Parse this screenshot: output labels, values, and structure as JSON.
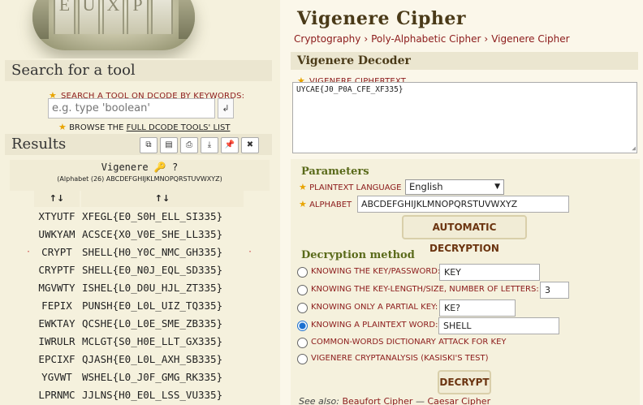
{
  "search": {
    "section_title": "Search for a tool",
    "label": "SEARCH A TOOL ON DCODE BY KEYWORDS:",
    "placeholder": "e.g. type 'boolean'",
    "browse_prefix": "BROWSE THE",
    "browse_link": "FULL DCODE TOOLS' LIST"
  },
  "results": {
    "section_title": "Results",
    "tool_name": "Vigenere",
    "alphabet_info": "(Alphabet (26) ABCDEFGHIJKLMNOPQRSTUVWXYZ)",
    "sort_icon": "↑↓",
    "rows": [
      {
        "key": "XTYUTF",
        "plain": "XFEGL{E0_S0H_ELL_SI335}"
      },
      {
        "key": "UWKYAM",
        "plain": "ACSCE{X0_V0E_SHE_LL335}"
      },
      {
        "key": "CRYPT",
        "plain": "SHELL{H0_Y0C_NMC_GH335}"
      },
      {
        "key": "CRYPTF",
        "plain": "SHELL{E0_N0J_EQL_SD335}"
      },
      {
        "key": "MGVWTY",
        "plain": "ISHEL{L0_D0U_HJL_ZT335}"
      },
      {
        "key": "FEPIX",
        "plain": "PUNSH{E0_L0L_UIZ_TQ335}"
      },
      {
        "key": "EWKTAY",
        "plain": "QCSHE{L0_L0E_SME_ZB335}"
      },
      {
        "key": "IWRULR",
        "plain": "MCLGT{S0_H0E_LLT_GX335}"
      },
      {
        "key": "EPCIXF",
        "plain": "QJASH{E0_L0L_AXH_SB335}"
      },
      {
        "key": "YGVWT",
        "plain": "WSHEL{L0_J0F_GMG_RK335}"
      },
      {
        "key": "LPRNMC",
        "plain": "JJLNS{H0_E0L_LSS_VU335}"
      }
    ]
  },
  "page": {
    "title": "Vigenere Cipher",
    "breadcrumb": [
      "Cryptography",
      "Poly-Alphabetic Cipher",
      "Vigenere Cipher"
    ]
  },
  "decoder": {
    "title": "Vigenere Decoder",
    "ciphertext_label": "VIGENERE CIPHERTEXT",
    "ciphertext": "UYCAE{J0_P0A_CFE_XF335}",
    "parameters_title": "Parameters",
    "language_label": "PLAINTEXT LANGUAGE",
    "language_value": "English",
    "alphabet_label": "ALPHABET",
    "alphabet_value": "ABCDEFGHIJKLMNOPQRSTUVWXYZ",
    "auto_button": "AUTOMATIC DECRYPTION",
    "method_title": "Decryption method",
    "methods": [
      {
        "label": "KNOWING THE KEY/PASSWORD:",
        "value": "KEY",
        "selected": false
      },
      {
        "label": "KNOWING THE KEY-LENGTH/SIZE, NUMBER OF LETTERS:",
        "value": "3",
        "selected": false
      },
      {
        "label": "KNOWING ONLY A PARTIAL KEY:",
        "value": "KE?",
        "selected": false
      },
      {
        "label": "KNOWING A PLAINTEXT WORD:",
        "value": "SHELL",
        "selected": true
      },
      {
        "label": "COMMON-WORDS DICTIONARY ATTACK FOR KEY",
        "selected": false
      },
      {
        "label": "VIGENERE CRYPTANALYSIS (KASISKI'S TEST)",
        "selected": false
      }
    ],
    "decrypt_button": "DECRYPT",
    "see_also_prefix": "See also:",
    "see_also_links": [
      "Beaufort Cipher",
      "Caesar Cipher"
    ]
  },
  "colors": {
    "accent_red": "#8b1a1a",
    "title_brown": "#4a3a18",
    "subtitle_green": "#5a6a1a",
    "panel_beige": "#f5f1dd"
  }
}
